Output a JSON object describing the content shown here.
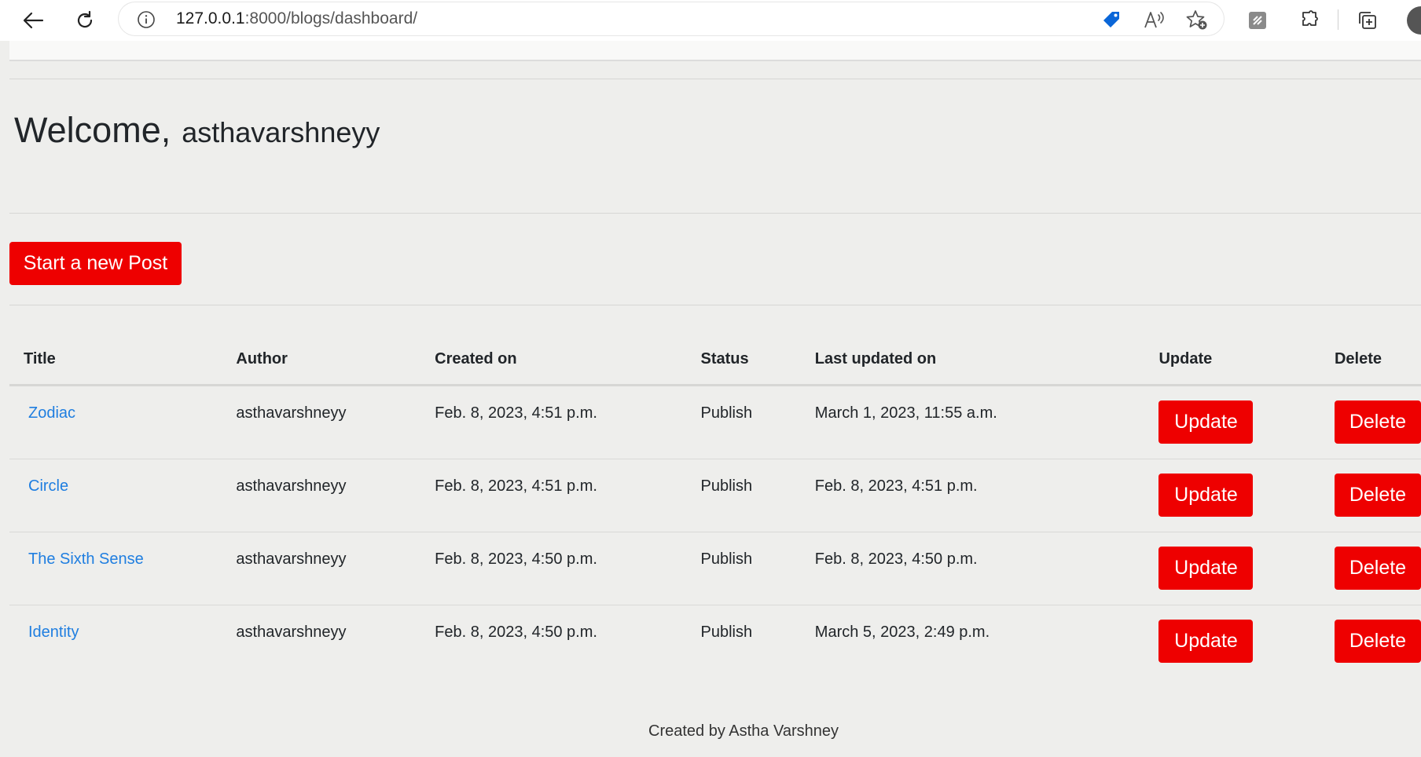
{
  "browser": {
    "url_host": "127.0.0.1",
    "url_rest": ":8000/blogs/dashboard/",
    "icons": [
      "back-arrow-icon",
      "refresh-icon",
      "info-icon",
      "tag-icon",
      "read-aloud-icon",
      "favorite-add-icon",
      "clipboard-icon",
      "extensions-icon",
      "collections-icon",
      "profile-avatar"
    ]
  },
  "header": {
    "welcome": "Welcome,",
    "username": "asthavarshneyy"
  },
  "actions": {
    "new_post": "Start a new Post"
  },
  "table": {
    "headers": [
      "Title",
      "Author",
      "Created on",
      "Status",
      "Last updated on",
      "Update",
      "Delete"
    ],
    "rows": [
      {
        "title": "Zodiac",
        "author": "asthavarshneyy",
        "created": "Feb. 8, 2023, 4:51 p.m.",
        "status": "Publish",
        "updated": "March 1, 2023, 11:55 a.m.",
        "update": "Update",
        "delete": "Delete"
      },
      {
        "title": "Circle",
        "author": "asthavarshneyy",
        "created": "Feb. 8, 2023, 4:51 p.m.",
        "status": "Publish",
        "updated": "Feb. 8, 2023, 4:51 p.m.",
        "update": "Update",
        "delete": "Delete"
      },
      {
        "title": "The Sixth Sense",
        "author": "asthavarshneyy",
        "created": "Feb. 8, 2023, 4:50 p.m.",
        "status": "Publish",
        "updated": "Feb. 8, 2023, 4:50 p.m.",
        "update": "Update",
        "delete": "Delete"
      },
      {
        "title": "Identity",
        "author": "asthavarshneyy",
        "created": "Feb. 8, 2023, 4:50 p.m.",
        "status": "Publish",
        "updated": "March 5, 2023, 2:49 p.m.",
        "update": "Update",
        "delete": "Delete"
      }
    ]
  },
  "footer": {
    "text": "Created by Astha Varshney"
  },
  "colors": {
    "accent_red": "#ee0000",
    "link_blue": "#1f7ee0",
    "page_bg": "#eeeeec"
  }
}
